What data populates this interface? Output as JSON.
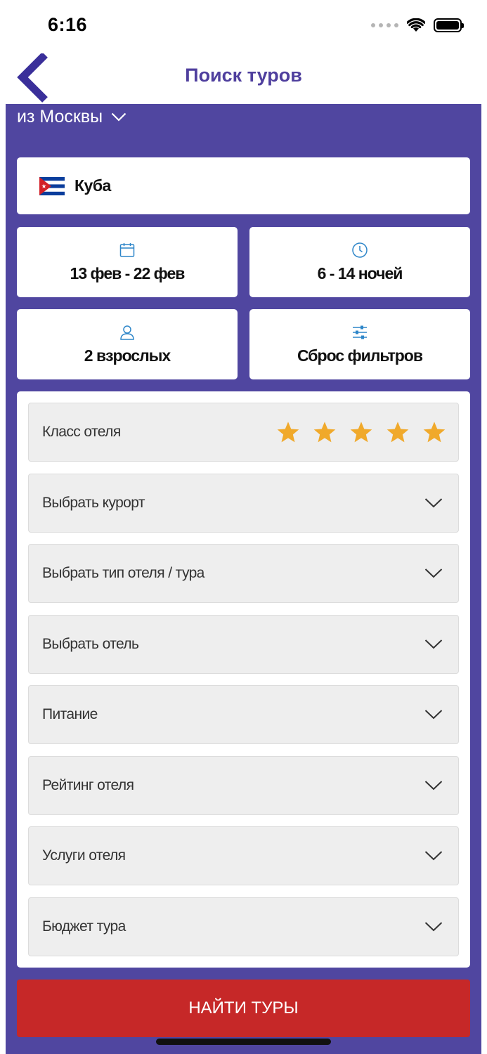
{
  "status_bar": {
    "time": "6:16",
    "battery_level": 1.0
  },
  "nav": {
    "title": "Поиск туров",
    "back_icon": "chevron-left-icon",
    "accent_color": "#4f3f9e"
  },
  "departure": {
    "label": "из Москвы",
    "icon": "chevron-down-icon"
  },
  "destination": {
    "country": "Куба",
    "flag": "cuba-flag-icon"
  },
  "tiles": {
    "dates": {
      "label": "13 фев - 22 фев",
      "icon": "calendar-icon"
    },
    "nights": {
      "label": "6 - 14 ночей",
      "icon": "clock-icon"
    },
    "travelers": {
      "label": "2 взрослых",
      "icon": "person-icon"
    },
    "reset": {
      "label": "Сброс фильтров",
      "icon": "sliders-icon"
    }
  },
  "filters": {
    "hotel_class": {
      "label": "Класс отеля",
      "stars_selected": 5,
      "stars_total": 5,
      "star_color": "#f0a92b"
    },
    "items": [
      {
        "label": "Выбрать курорт"
      },
      {
        "label": "Выбрать тип отеля / тура"
      },
      {
        "label": "Выбрать отель"
      },
      {
        "label": "Питание"
      },
      {
        "label": "Рейтинг отеля"
      },
      {
        "label": "Услуги отеля"
      },
      {
        "label": "Бюджет тура"
      }
    ]
  },
  "search_button": {
    "label": "НАЙТИ ТУРЫ",
    "color": "#c62828"
  },
  "colors": {
    "panel": "#5046a0",
    "icon_blue": "#2e86c9"
  }
}
